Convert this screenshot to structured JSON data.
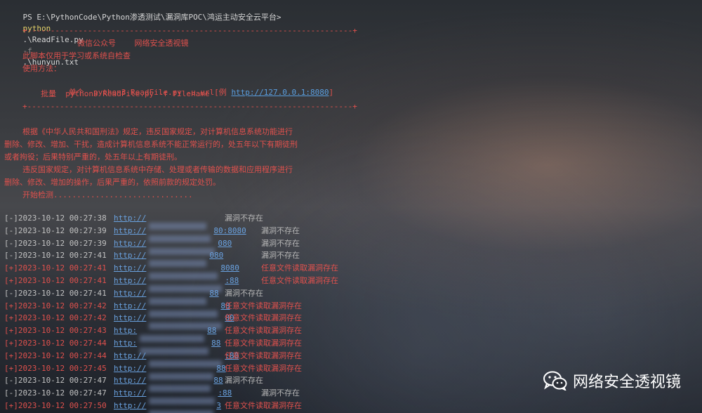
{
  "prompt": {
    "ps": "PS E:\\PythonCode\\Python渗透测试\\漏洞库POC\\鸿运主动安全云平台>",
    "cmd": "python",
    "arg": ".\\ReadFile.py",
    "flag": "-f",
    "file": ".\\hunyun.txt"
  },
  "banner": {
    "border": "+----------------------------------------------------------------------+",
    "title": "微信公众号    网络安全透视镜",
    "line1": "此脚本仅用于学习或系统自检查",
    "line2": "使用方法：",
    "usage1_prefix": "单个  python3 ReadFile.py -u url[例 ",
    "usage1_url": "http://127.0.0.1:8080",
    "usage1_suffix": "]",
    "usage2": "批量  python3 ReadFile.py -f filename"
  },
  "legal": {
    "p1a": "根据《中华人民共和国刑法》规定，违反国家规定，对计算机信息系统功能进行",
    "p1b": "删除、修改、增加、干扰，造成计算机信息系统不能正常运行的，处五年以下有期徒刑",
    "p1c": "或者拘役；后果特别严重的，处五年以上有期徒刑。",
    "p2a": "违反国家规定，对计算机信息系统中存储、处理或者传输的数据和应用程序进行",
    "p2b": "删除、修改、增加的操作，后果严重的，依照前款的规定处罚。",
    "start": "开始检测.............................."
  },
  "logs": [
    {
      "ts": "[-]2023-10-12 00:27:38",
      "url_prefix": "http://",
      "url_suffix": "",
      "status": "漏洞不存在",
      "ok": false
    },
    {
      "ts": "[-]2023-10-12 00:27:39",
      "url_prefix": "http://",
      "url_suffix": "80:8080",
      "status": "漏洞不存在",
      "ok": false
    },
    {
      "ts": "[-]2023-10-12 00:27:39",
      "url_prefix": "http://",
      "url_suffix": "080",
      "status": "漏洞不存在",
      "ok": false
    },
    {
      "ts": "[-]2023-10-12 00:27:41",
      "url_prefix": "http://",
      "url_suffix": "080",
      "status": "漏洞不存在",
      "ok": false
    },
    {
      "ts": "[+]2023-10-12 00:27:41",
      "url_prefix": "http://",
      "url_suffix": "8080",
      "status": "任意文件读取漏洞存在",
      "ok": true
    },
    {
      "ts": "[+]2023-10-12 00:27:41",
      "url_prefix": "http://",
      "url_suffix": ":88",
      "status": "任意文件读取漏洞存在",
      "ok": true
    },
    {
      "ts": "[-]2023-10-12 00:27:41",
      "url_prefix": "http://",
      "url_suffix": "88",
      "status": "漏洞不存在",
      "ok": false
    },
    {
      "ts": "[+]2023-10-12 00:27:42",
      "url_prefix": "http://",
      "url_suffix": "88",
      "status": "任意文件读取漏洞存在",
      "ok": true
    },
    {
      "ts": "[+]2023-10-12 00:27:42",
      "url_prefix": "http://",
      "url_suffix": "80",
      "status": "任意文件读取漏洞存在",
      "ok": true
    },
    {
      "ts": "[+]2023-10-12 00:27:43",
      "url_prefix": "http:",
      "url_suffix": "88",
      "status": "任意文件读取漏洞存在",
      "ok": true
    },
    {
      "ts": "[+]2023-10-12 00:27:44",
      "url_prefix": "http:",
      "url_suffix": "88",
      "status": "任意文件读取漏洞存在",
      "ok": true
    },
    {
      "ts": "[+]2023-10-12 00:27:44",
      "url_prefix": "http://",
      "url_suffix": ":88",
      "status": "任意文件读取漏洞存在",
      "ok": true
    },
    {
      "ts": "[+]2023-10-12 00:27:45",
      "url_prefix": "http://",
      "url_suffix": "88",
      "status": "任意文件读取漏洞存在",
      "ok": true
    },
    {
      "ts": "[-]2023-10-12 00:27:47",
      "url_prefix": "http://",
      "url_suffix": "88",
      "status": "漏洞不存在",
      "ok": false
    },
    {
      "ts": "[-]2023-10-12 00:27:47",
      "url_prefix": "http://",
      "url_suffix": ":88",
      "status": "漏洞不存在",
      "ok": false
    },
    {
      "ts": "[+]2023-10-12 00:27:50",
      "url_prefix": "http://",
      "url_suffix": "3",
      "status": "任意文件读取漏洞存在",
      "ok": true
    }
  ],
  "watermark": {
    "text": "网络安全透视镜",
    "icon": "wechat-icon"
  },
  "colors": {
    "red": "#e0514d",
    "link": "#6aa2e0",
    "command": "#e5d36a"
  }
}
